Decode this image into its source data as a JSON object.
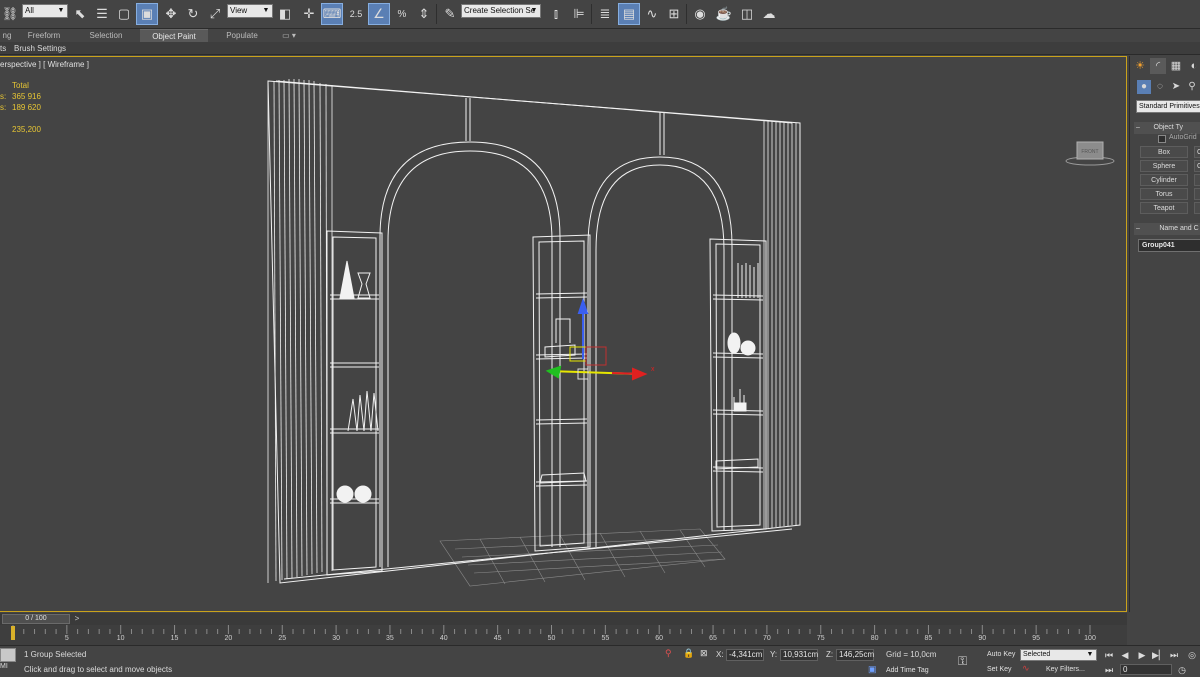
{
  "toolbar": {
    "selection_filter": "All",
    "reference_coordinate": "View",
    "named_selection_set": "Create Selection Se",
    "snap_value": "2.5",
    "icons": [
      "undo-icon",
      "link-icon",
      "select-object-icon",
      "select-by-name-icon",
      "rectangular-region-icon",
      "window-crossing-icon",
      "select-move-icon",
      "select-rotate-icon",
      "select-scale-icon",
      "pivot-center-icon",
      "select-manipulate-icon",
      "keyboard-shortcut-icon",
      "snaps-toggle-icon",
      "angle-snap-icon",
      "percent-snap-icon",
      "spinner-snap-icon",
      "edit-named-selection-icon",
      "mirror-icon",
      "align-icon",
      "layer-explorer-icon",
      "scene-explorer-icon",
      "curve-editor-icon",
      "schematic-view-icon",
      "material-editor-icon",
      "render-setup-icon",
      "rendered-frame-window-icon",
      "render-production-icon"
    ]
  },
  "ribbon": {
    "tabs": [
      "ng",
      "Freeform",
      "Selection",
      "Object Paint",
      "Populate"
    ],
    "active_tab": "Object Paint",
    "bar_items": [
      "ts",
      "Brush Settings"
    ]
  },
  "viewport": {
    "label": "erspective ] [ Wireframe ]",
    "stats": {
      "header": "Total",
      "polys_label": "s:",
      "polys_value": "365 916",
      "verts_label": "s:",
      "verts_value": "189 620",
      "fps_value": "235,200"
    },
    "viewcube_label": "FRONT"
  },
  "command_panel": {
    "tabs": [
      "create-icon",
      "modify-icon",
      "hierarchy-icon",
      "motion-icon"
    ],
    "subtabs": [
      "geometry-icon",
      "shapes-icon",
      "lights-icon",
      "cameras-icon"
    ],
    "category": "Standard Primitives",
    "object_type_header": "Object Ty",
    "autogrid_label": "AutoGrid",
    "primitives": [
      "Box",
      "Sphere",
      "Cylinder",
      "Torus",
      "Teapot"
    ],
    "primitives_col2": [
      "C",
      "G",
      "",
      "",
      ""
    ],
    "name_color_header": "Name and C",
    "object_name": "Group041"
  },
  "timeline": {
    "frame_display": "0 / 100",
    "ticks": [
      "5",
      "10",
      "15",
      "20",
      "25",
      "30",
      "35",
      "40",
      "45",
      "50",
      "55",
      "60",
      "65",
      "70",
      "75",
      "80",
      "85",
      "90",
      "95",
      "100"
    ]
  },
  "status": {
    "selection_info": "1 Group Selected",
    "prompt": "Click and drag to select and move objects",
    "maxscript_label": "ΜΙ",
    "x_label": "X:",
    "x_value": "-4,341cm",
    "y_label": "Y:",
    "y_value": "10,931cm",
    "z_label": "Z:",
    "z_value": "146,25cm",
    "grid": "Grid = 10,0cm",
    "add_time_tag": "Add Time Tag",
    "auto_key": "Auto Key",
    "set_key": "Set Key",
    "key_mode": "Selected",
    "key_filters": "Key Filters...",
    "current_frame": "0"
  }
}
